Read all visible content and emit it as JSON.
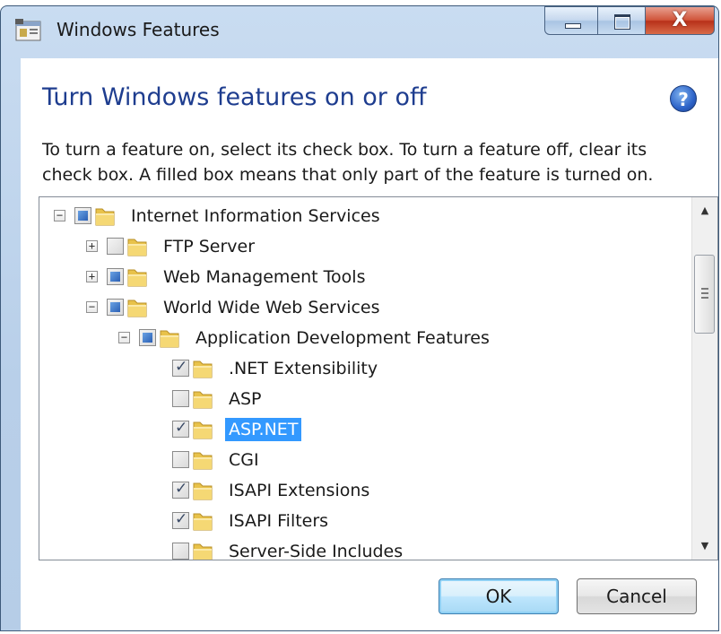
{
  "window": {
    "title": "Windows Features",
    "close_glyph": "X"
  },
  "dialog": {
    "heading": "Turn Windows features on or off",
    "help_icon_glyph": "?",
    "description": "To turn a feature on, select its check box. To turn a feature off, clear its check box. A filled box means that only part of the feature is turned on."
  },
  "tree": {
    "items": [
      {
        "label": "Internet Information Services",
        "state": "partial",
        "expander": "minus",
        "level": 0
      },
      {
        "label": "FTP Server",
        "state": "unchecked",
        "expander": "plus",
        "level": 1
      },
      {
        "label": "Web Management Tools",
        "state": "partial",
        "expander": "plus",
        "level": 1
      },
      {
        "label": "World Wide Web Services",
        "state": "partial",
        "expander": "minus",
        "level": 1
      },
      {
        "label": "Application Development Features",
        "state": "partial",
        "expander": "minus",
        "level": 2
      },
      {
        "label": ".NET Extensibility",
        "state": "checked",
        "expander": "none",
        "level": 3
      },
      {
        "label": "ASP",
        "state": "unchecked",
        "expander": "none",
        "level": 3
      },
      {
        "label": "ASP.NET",
        "state": "checked",
        "expander": "none",
        "level": 3,
        "selected": true
      },
      {
        "label": "CGI",
        "state": "unchecked",
        "expander": "none",
        "level": 3
      },
      {
        "label": "ISAPI Extensions",
        "state": "checked",
        "expander": "none",
        "level": 3
      },
      {
        "label": "ISAPI Filters",
        "state": "checked",
        "expander": "none",
        "level": 3
      },
      {
        "label": "Server-Side Includes",
        "state": "unchecked",
        "expander": "none",
        "level": 3
      }
    ],
    "expander_plus": "+",
    "expander_minus": "−"
  },
  "buttons": {
    "ok_label": "OK",
    "cancel_label": "Cancel"
  },
  "colors": {
    "heading": "#1e3d8f",
    "selection": "#3399ff",
    "partial_fill": "#2a5fb4",
    "folder": "#e8c24a"
  },
  "icons": {
    "app": "windows-features-icon",
    "help": "help-icon",
    "folder": "folder-icon",
    "scroll_up": "scroll-up-arrow-icon",
    "scroll_down": "scroll-down-arrow-icon"
  }
}
